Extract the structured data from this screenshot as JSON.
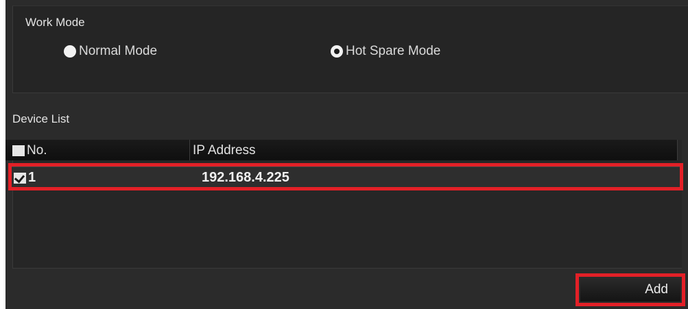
{
  "work_mode": {
    "title": "Work Mode",
    "options": [
      {
        "label": "Normal Mode",
        "selected": false
      },
      {
        "label": "Hot Spare Mode",
        "selected": true
      }
    ]
  },
  "device_list": {
    "title": "Device List",
    "columns": [
      "No.",
      "IP Address"
    ],
    "rows": [
      {
        "no": "1",
        "ip": "192.168.4.225",
        "checked": true
      }
    ]
  },
  "actions": {
    "add_label": "Add"
  },
  "colors": {
    "panel_bg": "#2b2b2b",
    "highlight": "#e32027",
    "text": "#e4e4e4"
  }
}
